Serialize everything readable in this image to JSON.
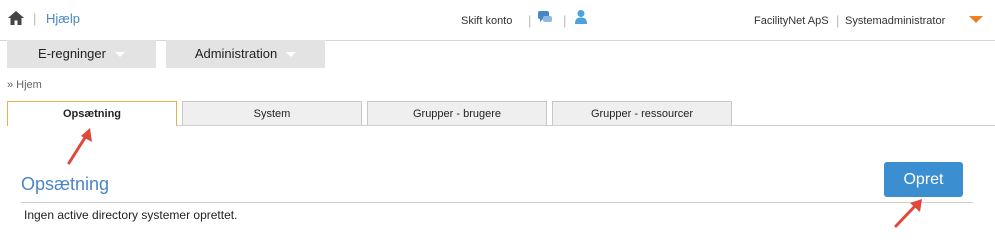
{
  "topbar": {
    "help_label": "Hjælp",
    "switch_account_label": "Skift konto",
    "company": "FacilityNet ApS",
    "role": "Systemadministrator",
    "separator": "|"
  },
  "menu": {
    "items": [
      {
        "label": "E-regninger"
      },
      {
        "label": "Administration"
      }
    ]
  },
  "breadcrumb": {
    "label": "» Hjem"
  },
  "tabs": [
    {
      "label": "Opsætning",
      "active": true
    },
    {
      "label": "System",
      "active": false
    },
    {
      "label": "Grupper - brugere",
      "active": false
    },
    {
      "label": "Grupper - ressourcer",
      "active": false
    }
  ],
  "main": {
    "section_title": "Opsætning",
    "create_button_label": "Opret",
    "empty_message": "Ingen active directory systemer oprettet."
  },
  "colors": {
    "accent_blue": "#4a86c5",
    "button_blue": "#3b8fd0",
    "orange": "#ef7d22",
    "annotation_arrow": "#e2473b"
  },
  "icons": {
    "home": "home-icon",
    "chat": "chat-bubbles-icon",
    "user": "user-icon",
    "caret": "caret-down-icon"
  }
}
